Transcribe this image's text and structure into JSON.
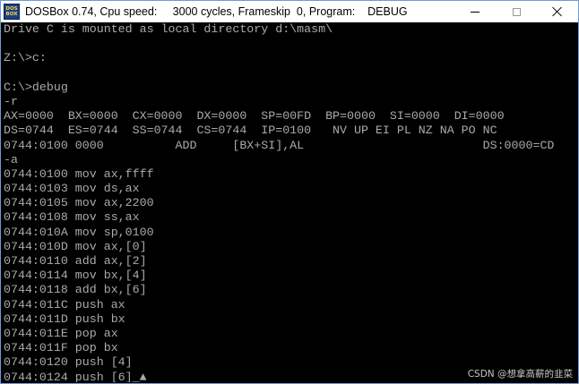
{
  "window": {
    "title": "DOSBox 0.74, Cpu speed:     3000 cycles, Frameskip  0, Program:    DEBUG",
    "icon_top": "DOS",
    "icon_bottom": "BOX",
    "minimize_icon": "minimize-icon",
    "maximize_icon": "maximize-icon",
    "close_icon": "close-icon"
  },
  "console": {
    "lines": [
      "Drive C is mounted as local directory d:\\masm\\",
      "",
      "Z:\\>c:",
      "",
      "C:\\>debug",
      "-r",
      "AX=0000  BX=0000  CX=0000  DX=0000  SP=00FD  BP=0000  SI=0000  DI=0000",
      "DS=0744  ES=0744  SS=0744  CS=0744  IP=0100   NV UP EI PL NZ NA PO NC",
      "0744:0100 0000          ADD     [BX+SI],AL                         DS:0000=CD",
      "-a",
      "0744:0100 mov ax,ffff",
      "0744:0103 mov ds,ax",
      "0744:0105 mov ax,2200",
      "0744:0108 mov ss,ax",
      "0744:010A mov sp,0100",
      "0744:010D mov ax,[0]",
      "0744:0110 add ax,[2]",
      "0744:0114 mov bx,[4]",
      "0744:0118 add bx,[6]",
      "0744:011C push ax",
      "0744:011D push bx",
      "0744:011E pop ax",
      "0744:011F pop bx",
      "0744:0120 push [4]",
      "0744:0124 push [6]"
    ],
    "cursor": "_▲",
    "text_color": "#aaaaaa",
    "background": "#000000"
  },
  "watermark": "CSDN @想拿高薪的韭菜"
}
